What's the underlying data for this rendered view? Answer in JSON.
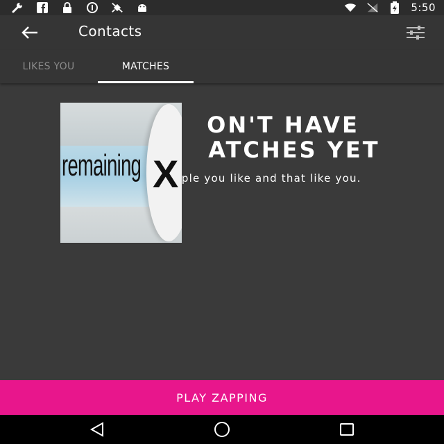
{
  "status_bar": {
    "left_icons": [
      "wrench-icon",
      "facebook-icon",
      "lock-icon",
      "info-icon",
      "no-satellite-icon",
      "android-icon"
    ],
    "right_icons": [
      "wifi-icon",
      "no-signal-icon",
      "battery-charging-icon"
    ],
    "time": "5:50"
  },
  "app_bar": {
    "title": "Contacts",
    "back_icon": "arrow-back-icon",
    "action_icon": "filters-icon"
  },
  "tabs": [
    {
      "label": "LIKES YOU",
      "selected": false
    },
    {
      "label": "MATCHES",
      "selected": true
    }
  ],
  "empty_state": {
    "headline_line1": "ON'T HAVE",
    "headline_line2_left": "A",
    "headline_line2_right": "ATCHES YET",
    "subtitle": "Matches are people you like and that like you."
  },
  "overlay_ad": {
    "text": "remaining",
    "close_glyph": "X"
  },
  "cta": {
    "label": "PLAY ZAPPING"
  },
  "nav_bar": {
    "icons": [
      "back-icon",
      "home-icon",
      "recents-icon"
    ]
  },
  "colors": {
    "background": "#3a3a3a",
    "app_bar": "#353535",
    "accent": "#e8168c",
    "text": "#ffffff",
    "inactive_tab": "#8a8a8a"
  }
}
